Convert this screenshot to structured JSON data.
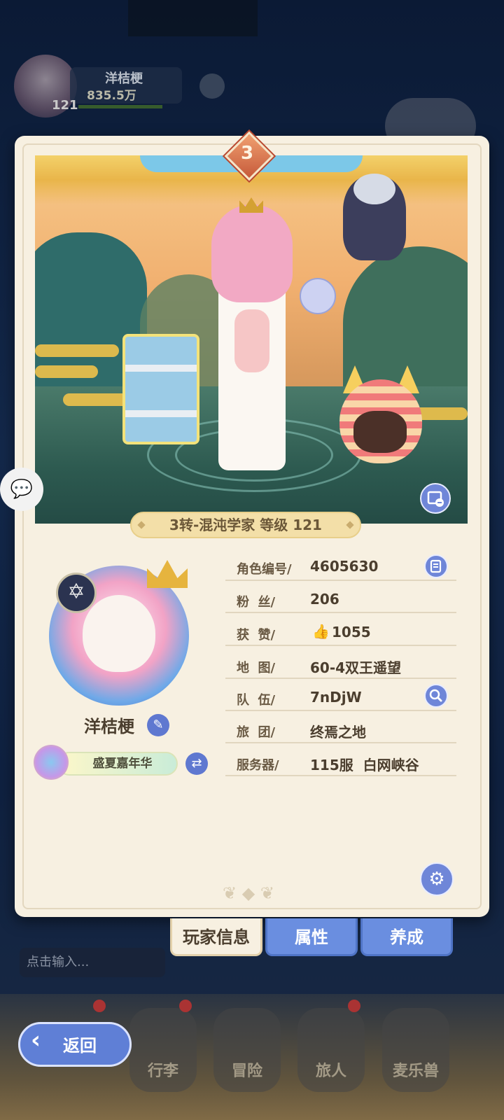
{
  "hud": {
    "player_name": "洋桔梗",
    "power": "835.5万",
    "level": "121"
  },
  "panel": {
    "rank_badge": "3",
    "class_line": "3转-混沌学家 等级 121",
    "player_name": "洋桔梗",
    "title": "盛夏嘉年华",
    "rows": [
      {
        "label": "角色编号/",
        "value": "4605630",
        "action_icon": "copy-icon"
      },
      {
        "label": "粉  丝/",
        "value": "206"
      },
      {
        "label": "获  赞/",
        "value": "1055",
        "icon": "thumbs-up-icon"
      },
      {
        "label": "地  图/",
        "value": "60-4双王遥望"
      },
      {
        "label": "队  伍/",
        "value": "7nDjW",
        "action_icon": "search-icon"
      },
      {
        "label": "旅  团/",
        "value": "终焉之地"
      },
      {
        "label": "服务器/",
        "value": "115服  白网峡谷"
      }
    ]
  },
  "tabs": [
    {
      "label": "玩家信息",
      "active": true
    },
    {
      "label": "属性",
      "active": false
    },
    {
      "label": "养成",
      "active": false
    }
  ],
  "chat": {
    "placeholder": "点击输入..."
  },
  "nav": {
    "back_label": "返回",
    "items": [
      "行李",
      "冒险",
      "旅人",
      "麦乐兽"
    ]
  },
  "colors": {
    "accent_blue": "#6f86d8",
    "panel_bg": "#f7f0e1",
    "text_brown": "#4b3e2e"
  }
}
